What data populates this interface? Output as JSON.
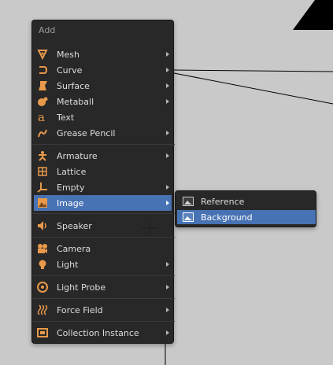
{
  "menu": {
    "title": "Add",
    "items": [
      {
        "label": "Mesh",
        "icon": "mesh-icon",
        "has_submenu": true
      },
      {
        "label": "Curve",
        "icon": "curve-icon",
        "has_submenu": true
      },
      {
        "label": "Surface",
        "icon": "surface-icon",
        "has_submenu": true
      },
      {
        "label": "Metaball",
        "icon": "metaball-icon",
        "has_submenu": true
      },
      {
        "label": "Text",
        "icon": "text-icon",
        "has_submenu": false
      },
      {
        "label": "Grease Pencil",
        "icon": "grease-pencil-icon",
        "has_submenu": true
      },
      {
        "label": "Armature",
        "icon": "armature-icon",
        "has_submenu": true
      },
      {
        "label": "Lattice",
        "icon": "lattice-icon",
        "has_submenu": false
      },
      {
        "label": "Empty",
        "icon": "empty-icon",
        "has_submenu": true
      },
      {
        "label": "Image",
        "icon": "image-icon",
        "has_submenu": true,
        "active": true
      },
      {
        "label": "Speaker",
        "icon": "speaker-icon",
        "has_submenu": false
      },
      {
        "label": "Camera",
        "icon": "camera-icon",
        "has_submenu": false
      },
      {
        "label": "Light",
        "icon": "light-icon",
        "has_submenu": true
      },
      {
        "label": "Light Probe",
        "icon": "light-probe-icon",
        "has_submenu": true
      },
      {
        "label": "Force Field",
        "icon": "force-field-icon",
        "has_submenu": true
      },
      {
        "label": "Collection Instance",
        "icon": "collection-instance-icon",
        "has_submenu": true
      }
    ]
  },
  "submenu": {
    "items": [
      {
        "label": "Reference",
        "icon": "image-reference-icon"
      },
      {
        "label": "Background",
        "icon": "image-background-icon",
        "active": true
      }
    ]
  },
  "colors": {
    "menu_bg": "#282828",
    "highlight": "#4772b3",
    "icon_accent": "#e8994a",
    "viewport_bg": "#c9c9c9"
  }
}
